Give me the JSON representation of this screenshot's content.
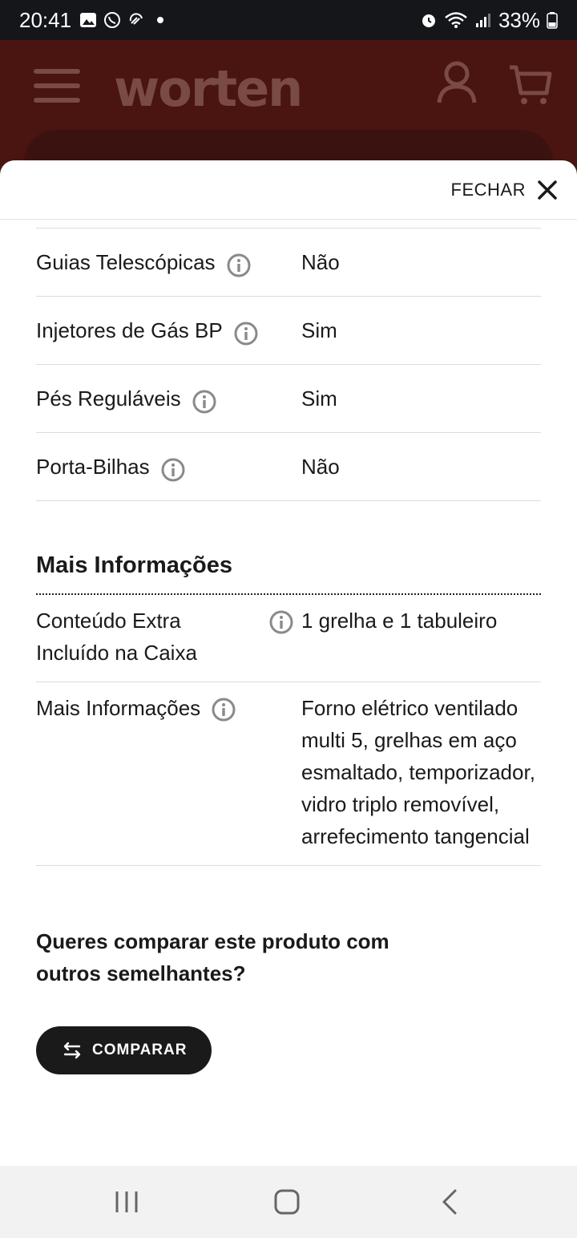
{
  "status_bar": {
    "time": "20:41",
    "battery": "33%"
  },
  "app_header": {
    "logo": "worten"
  },
  "sheet": {
    "close_label": "FECHAR",
    "spec_rows": [
      {
        "label": "Guias Telescópicas",
        "value": "Não"
      },
      {
        "label": "Injetores de Gás BP",
        "value": "Sim"
      },
      {
        "label": "Pés Reguláveis",
        "value": "Sim"
      },
      {
        "label": "Porta-Bilhas",
        "value": "Não"
      }
    ],
    "more_info": {
      "title": "Mais Informações",
      "rows": [
        {
          "label": "Conteúdo Extra Incluído na Caixa",
          "value": "1 grelha e 1 tabuleiro"
        },
        {
          "label": "Mais Informações",
          "value": "Forno elétrico ventilado multi 5, grelhas em aço esmaltado, temporizador, vidro triplo removível, arrefecimento tangencial"
        }
      ]
    },
    "compare": {
      "question": "Queres comparar este produto com outros semelhantes?",
      "button_label": "COMPARAR"
    }
  },
  "colors": {
    "header_bg": "#5a1a14",
    "button_bg": "#1a1a1a",
    "info_icon": "#8a8a8a"
  }
}
